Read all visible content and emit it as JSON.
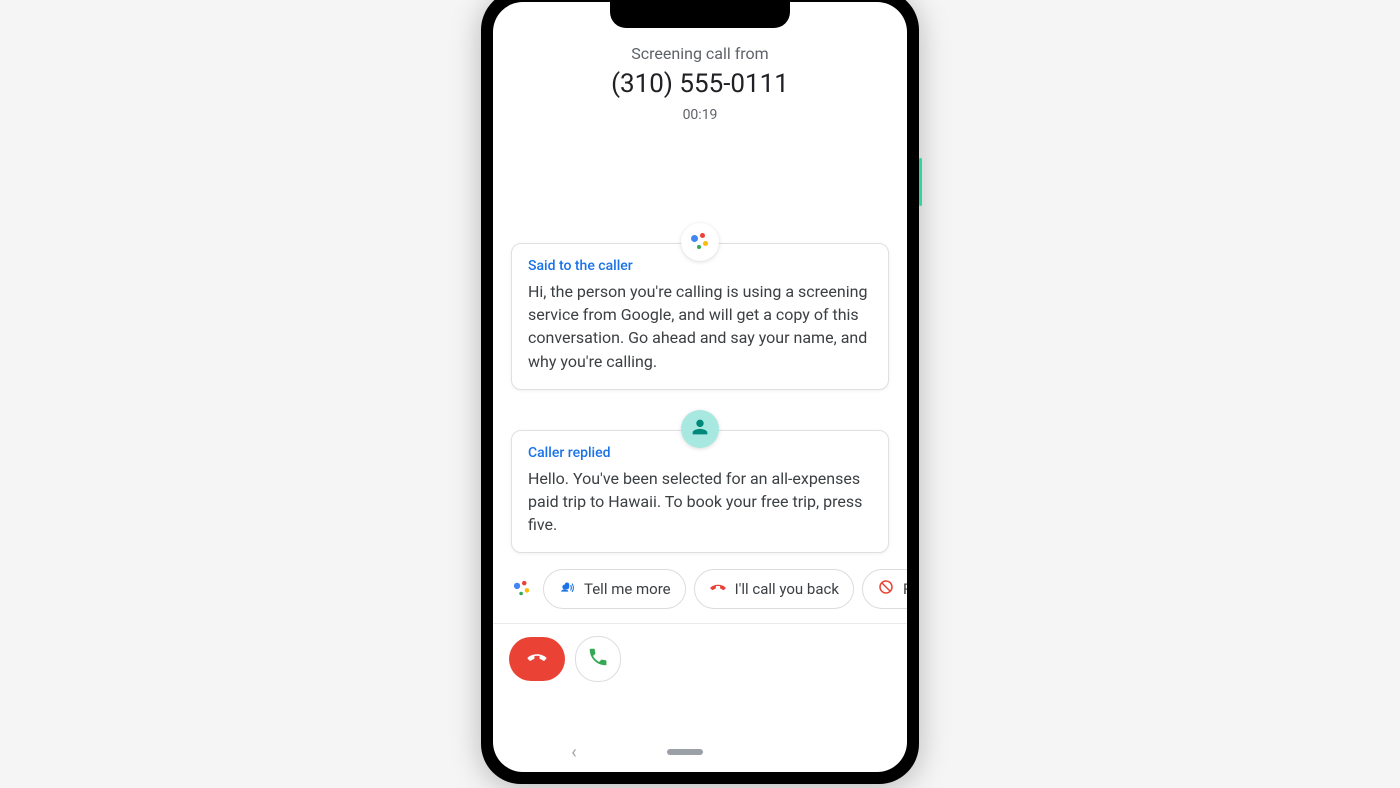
{
  "header": {
    "subtitle": "Screening call from",
    "number": "(310) 555-0111",
    "duration": "00:19"
  },
  "messages": [
    {
      "sender": "assistant",
      "label": "Said to the caller",
      "text": "Hi, the person you're calling is using a screening service from Google, and will get a copy of this conversation. Go ahead and say your name, and why you're calling."
    },
    {
      "sender": "caller",
      "label": "Caller replied",
      "text": "Hello. You've been selected for an all-expenses paid trip to Hawaii. To book your free trip, press five."
    }
  ],
  "chips": {
    "tell_more": "Tell me more",
    "call_back": "I'll call you back",
    "report_partial": "R"
  },
  "colors": {
    "blue": "#1a73e8",
    "red": "#ea4335",
    "green": "#34a853",
    "teal": "#a7e8e0"
  }
}
